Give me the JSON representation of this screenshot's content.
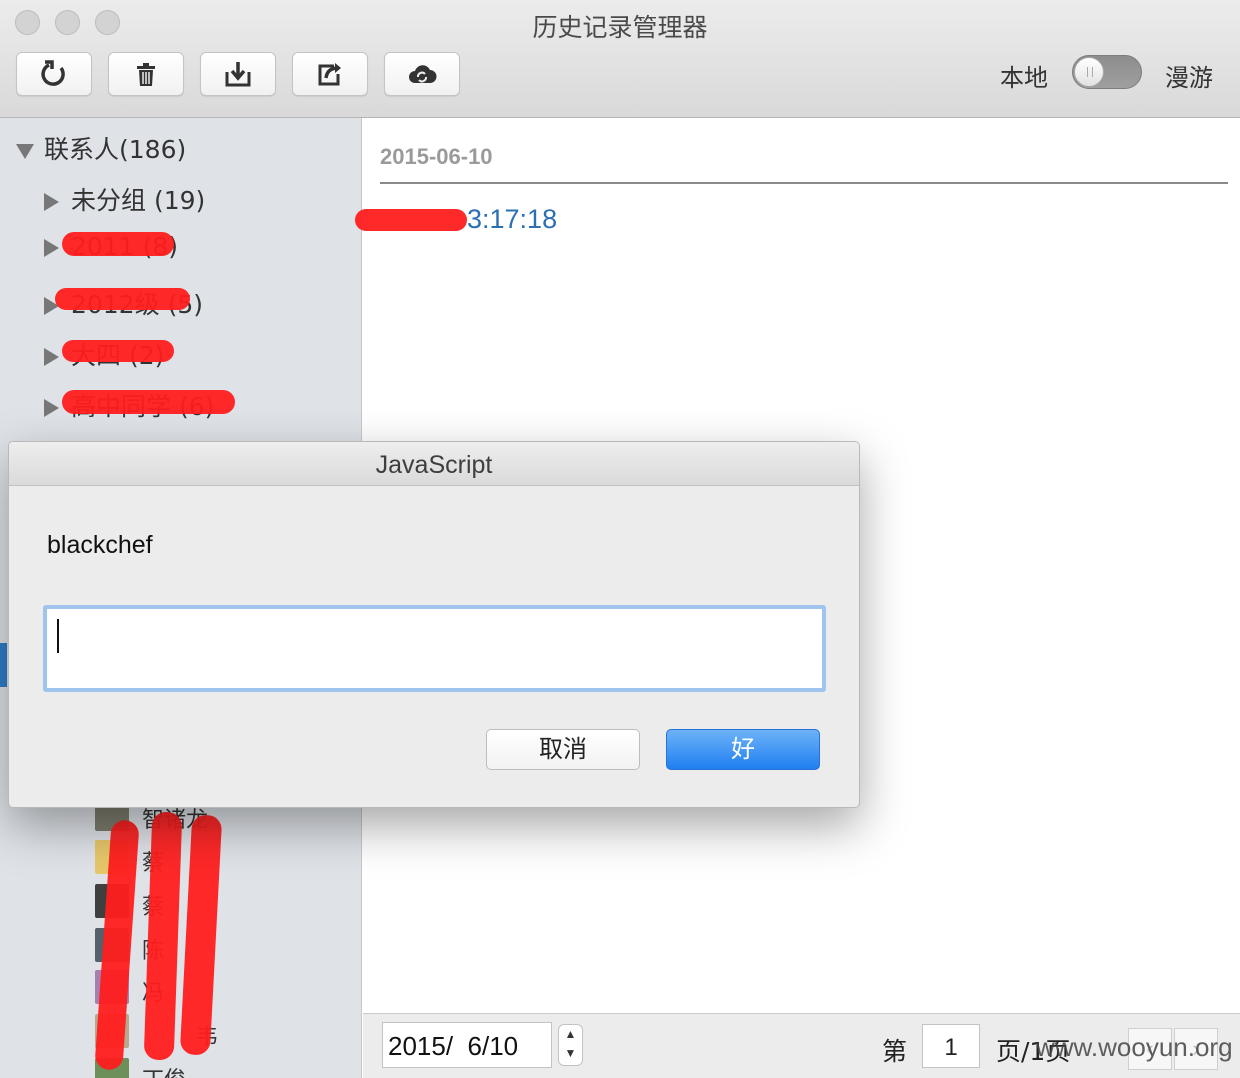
{
  "window": {
    "title": "历史记录管理器"
  },
  "toolbar": {
    "buttons": [
      {
        "icon": "refresh-icon"
      },
      {
        "icon": "trash-icon"
      },
      {
        "icon": "import-icon"
      },
      {
        "icon": "export-icon"
      },
      {
        "icon": "cloud-sync-icon"
      }
    ],
    "local_label": "本地",
    "roaming_label": "漫游",
    "toggle_on": false
  },
  "sidebar": {
    "root_label": "联系人(186)",
    "groups": [
      {
        "label": "未分组 (19)"
      },
      {
        "label": "2011 (8)"
      },
      {
        "label": "2012级 (5)"
      },
      {
        "label": "大四 (2)"
      },
      {
        "label": "高中同学 (6)"
      }
    ],
    "contacts": [
      {
        "label": "智诸龙"
      },
      {
        "label": "蔡"
      },
      {
        "label": "蔡"
      },
      {
        "label": "陈"
      },
      {
        "label": "冯"
      },
      {
        "label": "韦"
      },
      {
        "label": "丁俊"
      }
    ]
  },
  "content": {
    "date_header": "2015-06-10",
    "message_time": "3:17:18"
  },
  "bottombar": {
    "date_value": "2015/  6/10",
    "page_prefix": "第",
    "page_value": "1",
    "page_suffix": "页/1页",
    "prev_glyph": "‹",
    "next_glyph": "›",
    "watermark": "www.wooyun.org"
  },
  "dialog": {
    "title": "JavaScript",
    "message": "blackchef",
    "input_value": "",
    "cancel_label": "取消",
    "ok_label": "好"
  }
}
